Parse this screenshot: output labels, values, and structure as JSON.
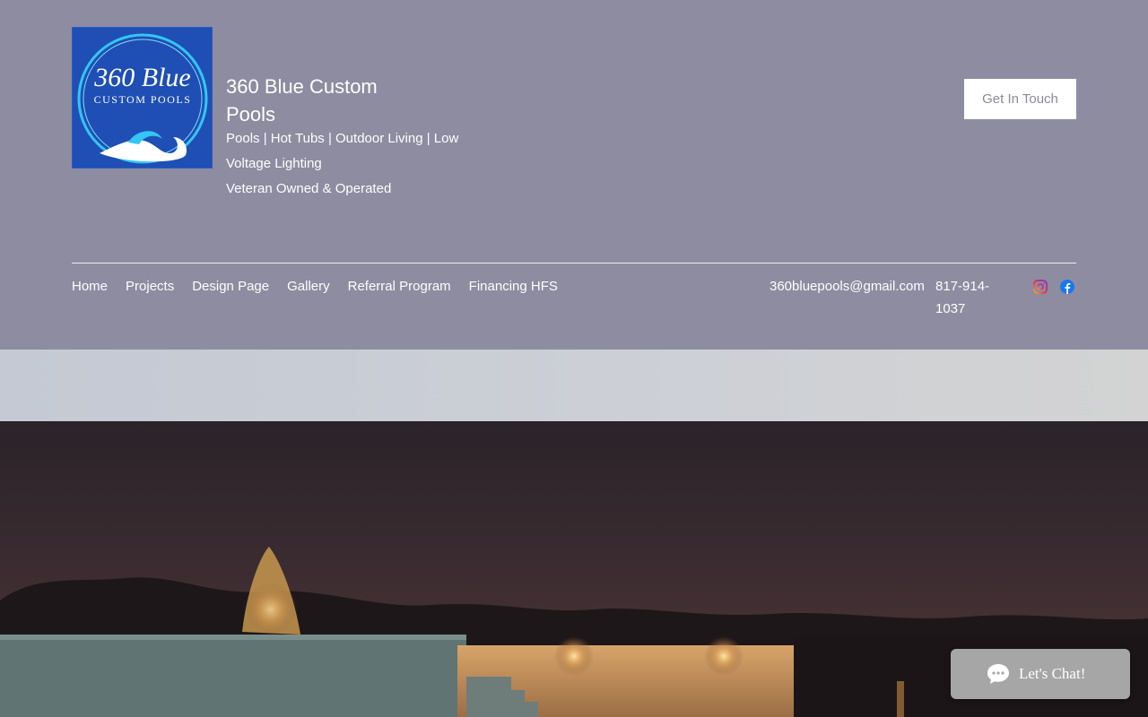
{
  "brand": {
    "logo_text_line1": "360 Blue",
    "logo_text_line2": "CUSTOM POOLS",
    "title": "360 Blue Custom Pools",
    "tagline": "Pools | Hot Tubs | Outdoor Living | Low Voltage Lighting",
    "tagline2": "Veteran Owned & Operated"
  },
  "header": {
    "cta_label": "Get In Touch"
  },
  "nav": {
    "items": [
      {
        "label": "Home"
      },
      {
        "label": "Projects"
      },
      {
        "label": "Design Page"
      },
      {
        "label": "Gallery"
      },
      {
        "label": "Referral Program"
      },
      {
        "label": "Financing HFS"
      }
    ]
  },
  "contact": {
    "email": "360bluepools@gmail.com",
    "phone": "817-914-1037"
  },
  "social": {
    "icons": [
      "instagram-icon",
      "facebook-icon"
    ]
  },
  "chat": {
    "label": "Let's Chat!"
  },
  "colors": {
    "header_bg": "#8d8ca0",
    "logo_bg": "#1f4fb4",
    "chat_bg": "#a6a6a6",
    "facebook_blue": "#1877f2"
  }
}
